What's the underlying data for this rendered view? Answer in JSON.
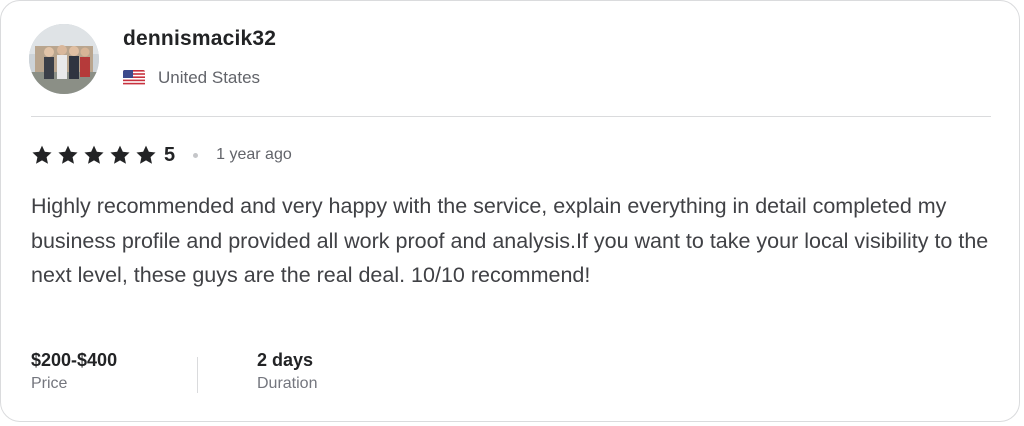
{
  "reviewer": {
    "username": "dennismacik32",
    "country": "United States",
    "flag_icon": "us-flag-icon"
  },
  "review": {
    "rating_stars": 5,
    "rating_value": "5",
    "time_ago": "1 year ago",
    "text": "Highly recommended and very happy with the service, explain everything in detail completed my business profile and provided all work proof and analysis.If you want to take your local visibility to the next level, these guys are the real deal. 10/10 recommend!"
  },
  "details": {
    "price": {
      "value": "$200-$400",
      "label": "Price"
    },
    "duration": {
      "value": "2 days",
      "label": "Duration"
    }
  },
  "colors": {
    "star": "#222325",
    "text_primary": "#222325",
    "text_secondary": "#62646a",
    "border": "#dadbdd"
  }
}
